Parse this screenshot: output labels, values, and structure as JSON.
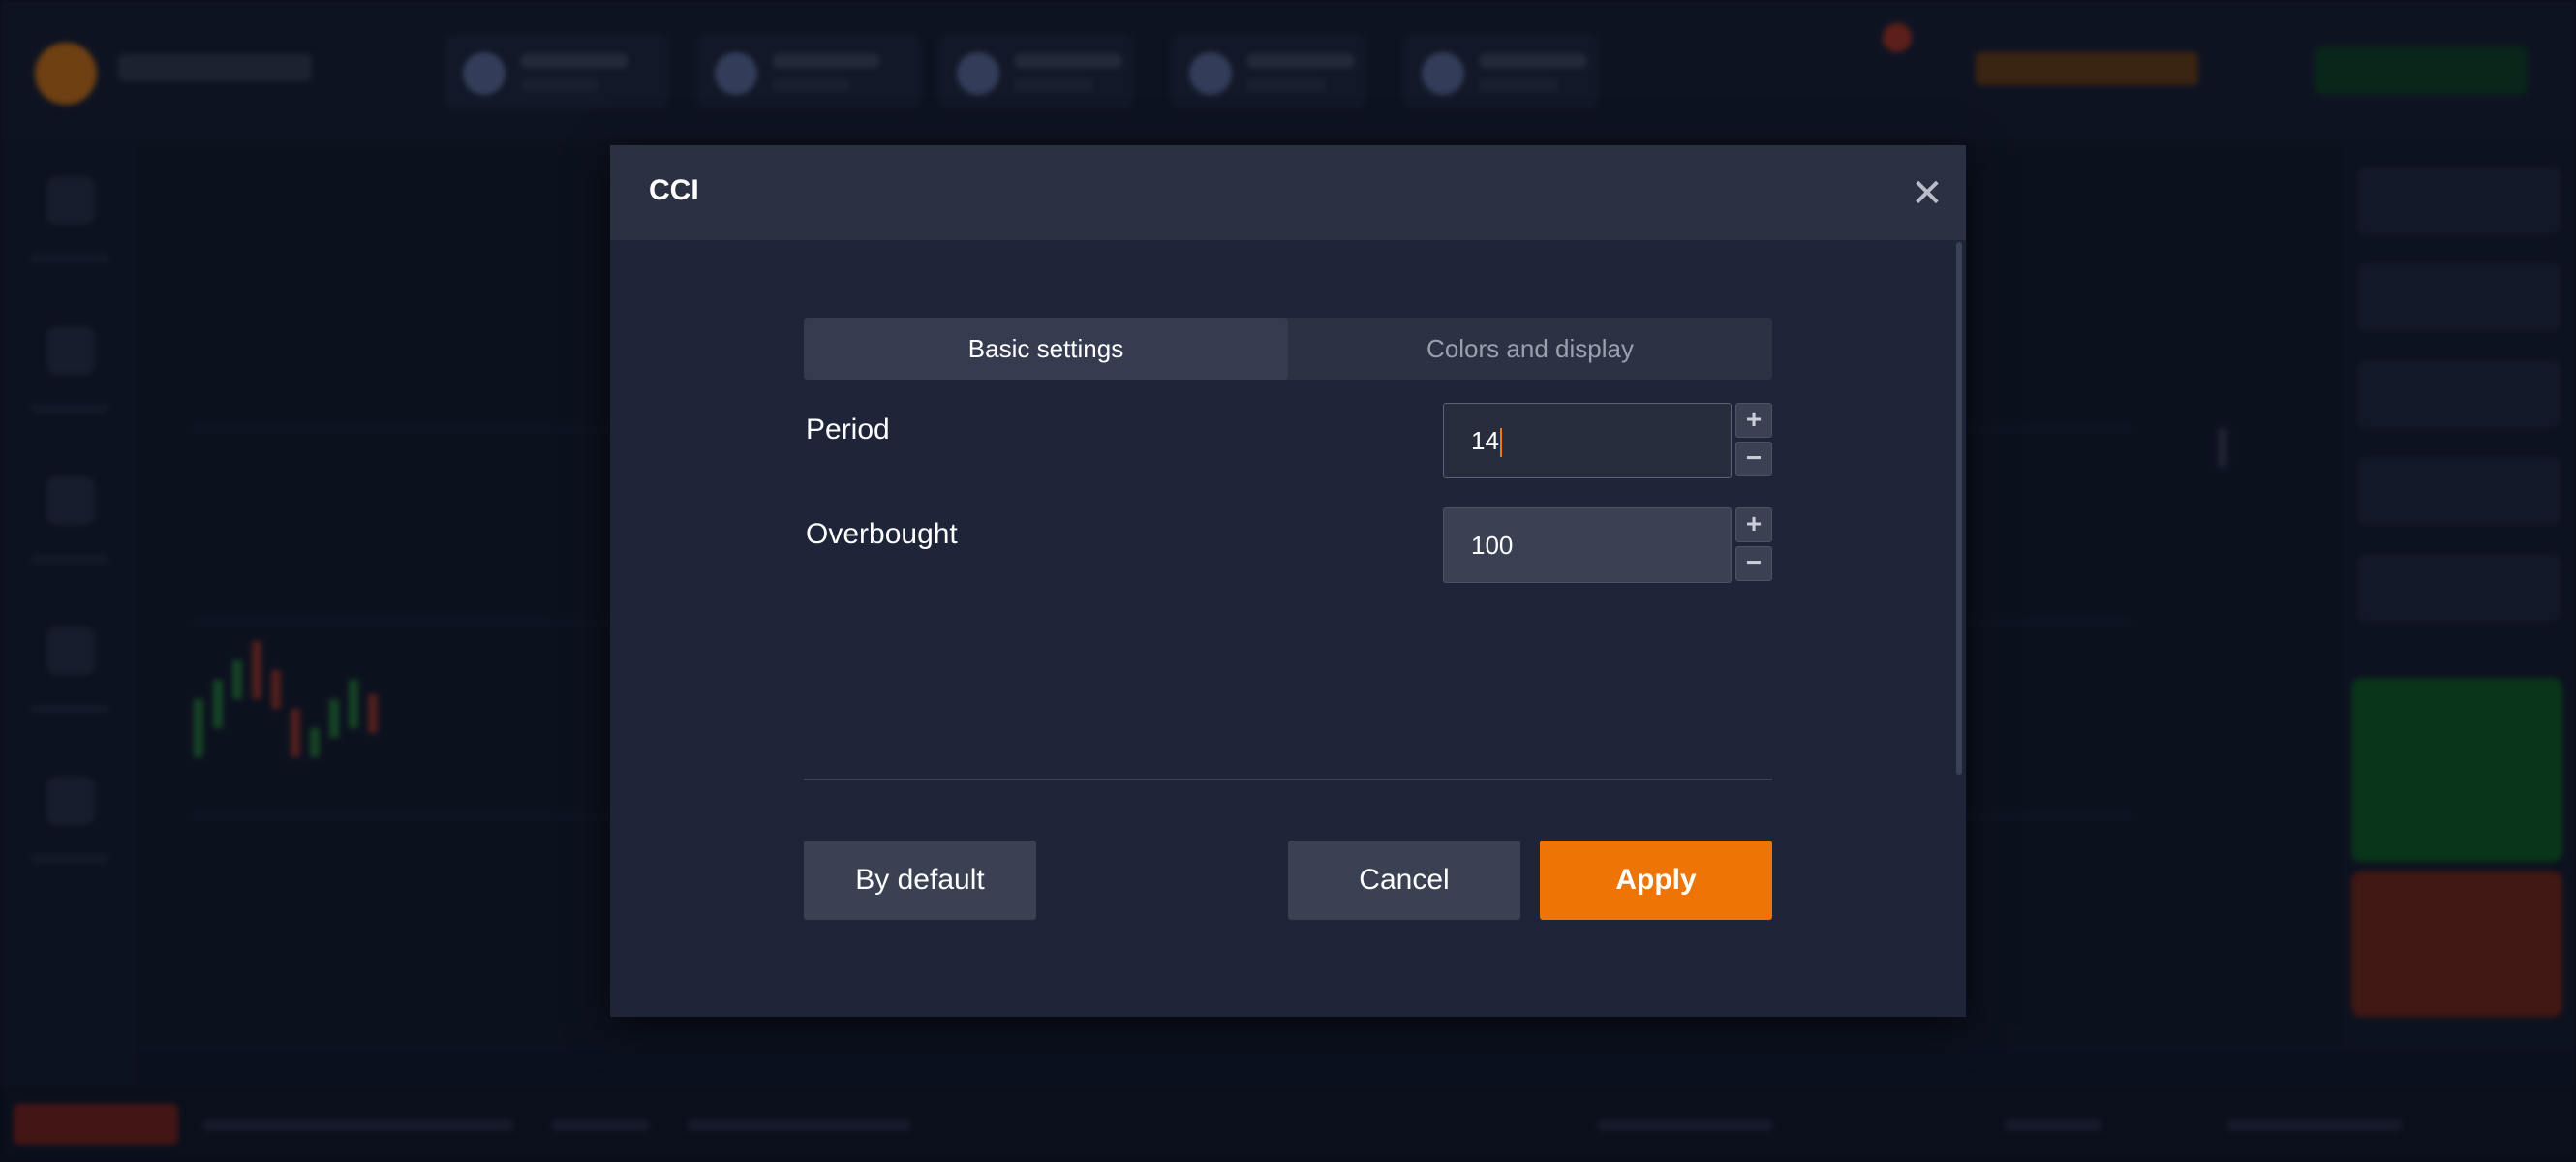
{
  "dialog": {
    "title": "CCI",
    "close_icon": "close-icon"
  },
  "tabs": [
    {
      "label": "Basic settings",
      "active": true
    },
    {
      "label": "Colors and display",
      "active": false
    }
  ],
  "fields": [
    {
      "label": "Period",
      "value": "14",
      "focused": true
    },
    {
      "label": "Overbought",
      "value": "100",
      "focused": false
    }
  ],
  "stepper": {
    "plus": "+",
    "minus": "−"
  },
  "buttons": {
    "default_label": "By default",
    "cancel_label": "Cancel",
    "apply_label": "Apply"
  },
  "colors": {
    "accent": "#ee7406",
    "modal_bg": "#1e2539",
    "header_bg": "#2a3142"
  }
}
